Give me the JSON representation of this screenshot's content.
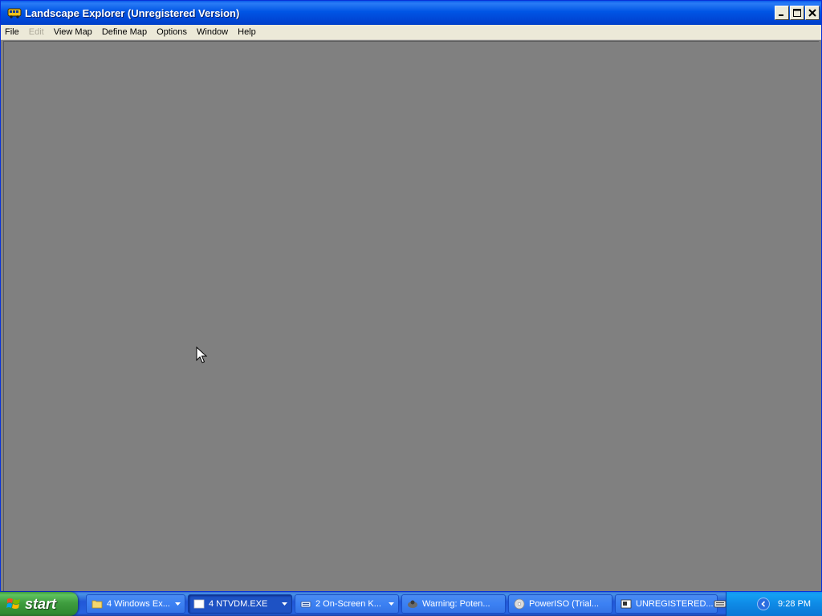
{
  "window": {
    "title": "Landscape Explorer (Unregistered Version)",
    "icon": "bus-icon"
  },
  "menubar": {
    "items": [
      {
        "label": "File",
        "enabled": true
      },
      {
        "label": "Edit",
        "enabled": false
      },
      {
        "label": "View Map",
        "enabled": true
      },
      {
        "label": "Define Map",
        "enabled": true
      },
      {
        "label": "Options",
        "enabled": true
      },
      {
        "label": "Window",
        "enabled": true
      },
      {
        "label": "Help",
        "enabled": true
      }
    ]
  },
  "taskbar": {
    "start_label": "start",
    "buttons": [
      {
        "label": "4 Windows Ex...",
        "icon": "folder-icon",
        "grouped": true,
        "active": false
      },
      {
        "label": "4 NTVDM.EXE",
        "icon": "window-icon",
        "grouped": true,
        "active": true
      },
      {
        "label": "2 On-Screen K...",
        "icon": "keyboard-icon",
        "grouped": true,
        "active": false
      },
      {
        "label": "Warning: Poten...",
        "icon": "warning-icon",
        "grouped": false,
        "active": false
      },
      {
        "label": "PowerISO (Trial...",
        "icon": "disc-icon",
        "grouped": false,
        "active": false
      },
      {
        "label": "UNREGISTERED...",
        "icon": "app-icon",
        "grouped": false,
        "active": false
      }
    ],
    "clock": "9:28 PM"
  },
  "colors": {
    "titlebar": "#0055e5",
    "workspace": "#808080",
    "menubar": "#ece9d8",
    "taskbar": "#2663e0",
    "start": "#3f9d3f",
    "tray": "#0e8ae6"
  }
}
